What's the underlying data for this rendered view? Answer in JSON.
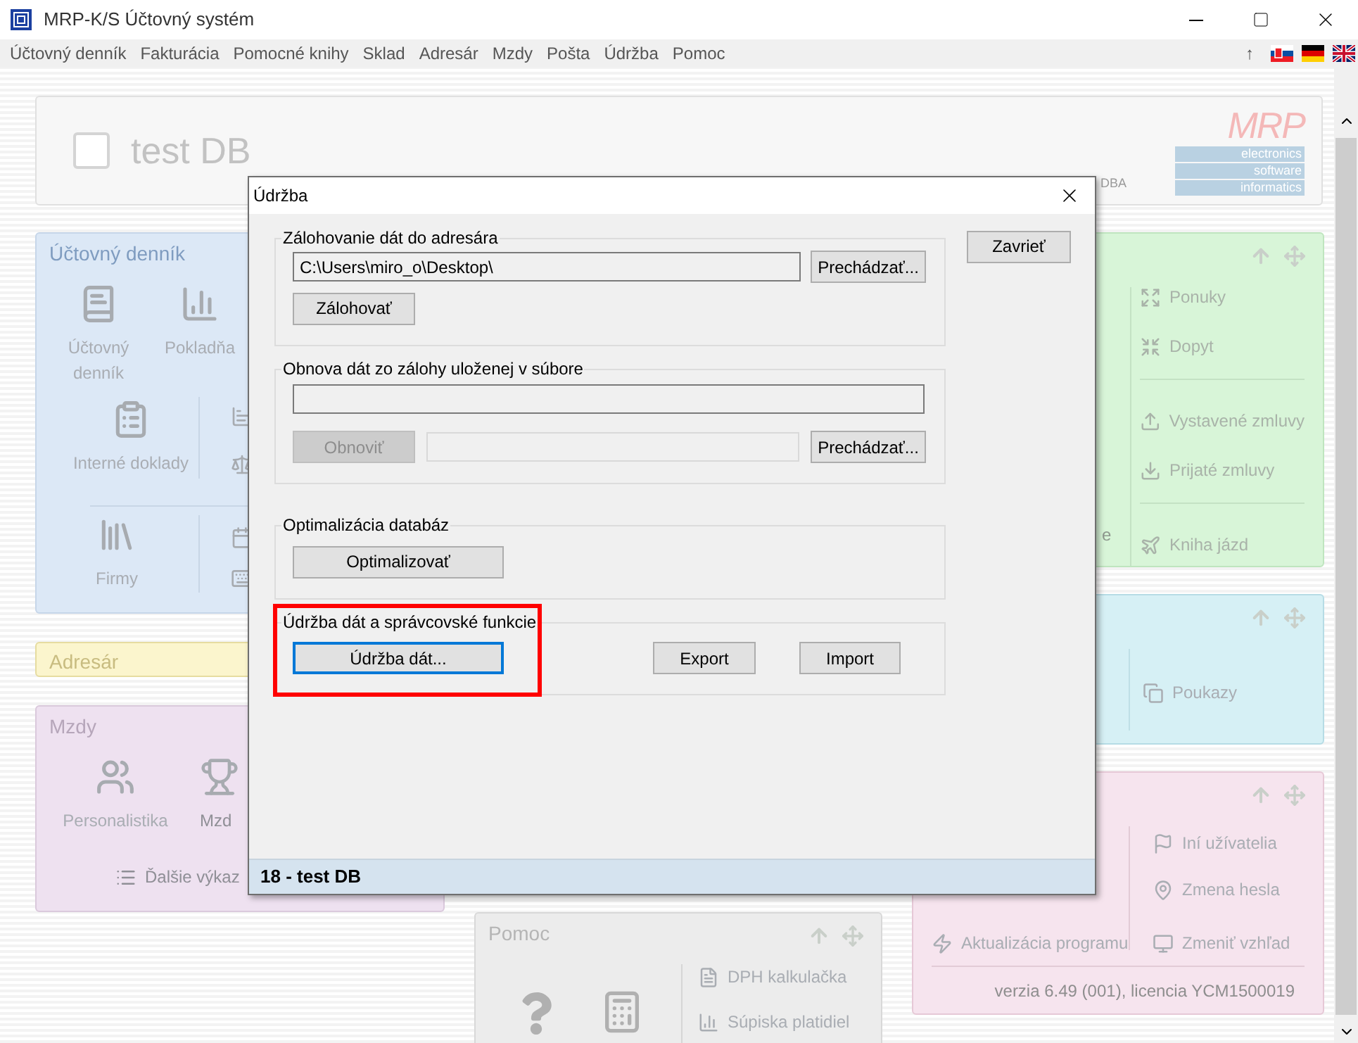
{
  "window": {
    "title": "MRP-K/S Účtovný systém"
  },
  "menu": {
    "items": [
      "Účtovný denník",
      "Fakturácia",
      "Pomocné knihy",
      "Sklad",
      "Adresár",
      "Mzdy",
      "Pošta",
      "Údržba",
      "Pomoc"
    ],
    "up_label": "↑"
  },
  "header": {
    "title": "test DB",
    "checked": false,
    "hidden_text": "DBA",
    "logo": {
      "mark": "MRP",
      "lines": [
        "electronics",
        "software",
        "informatics"
      ]
    }
  },
  "ledger_card": {
    "title": "Účtovný denník",
    "tiles": [
      "Účtovný denník",
      "Pokladňa",
      "Interné doklady",
      "Firmy"
    ]
  },
  "address_card": {
    "title": "Adresár"
  },
  "payroll_card": {
    "title": "Mzdy",
    "tiles": [
      "Personalistika",
      "Mzd"
    ],
    "link": "Ďalšie výkaz"
  },
  "help_card": {
    "title": "Pomoc",
    "links": [
      "DPH kalkulačka",
      "Súpiska platidiel"
    ]
  },
  "contracts_card": {
    "partial_label": "e",
    "link_groups": [
      {
        "links": [
          "Ponuky",
          "Dopyt"
        ]
      },
      {
        "links": [
          "Vystavené zmluvy",
          "Prijaté zmluvy"
        ]
      },
      {
        "links": [
          "Kniha jázd"
        ]
      }
    ]
  },
  "vouchers_card": {
    "links": [
      "Poukazy"
    ]
  },
  "settings_card": {
    "links": [
      "Iní užívatelia",
      "Zmena hesla"
    ],
    "update_link": "Aktualizácia programu",
    "look_link": "Zmeniť vzhľad",
    "version": "verzia 6.49 (001), licencia YCM1500019"
  },
  "dialog": {
    "title": "Údržba",
    "close_button": "Zavrieť",
    "status": "18 - test DB",
    "groups": [
      {
        "kind": "backup",
        "title": "Zálohovanie dát do adresára",
        "highlighted": false,
        "field": {
          "value": "C:\\Users\\miro_o\\Desktop\\"
        },
        "buttons": [
          {
            "label": "Prechádzať...",
            "disabled": false,
            "focused": false
          },
          {
            "label": "Zálohovať",
            "disabled": false,
            "focused": false
          }
        ]
      },
      {
        "kind": "restore",
        "title": "Obnova dát zo zálohy uloženej v súbore",
        "highlighted": false,
        "buttons": [
          {
            "label": "Obnoviť",
            "disabled": true,
            "focused": false
          },
          {
            "label": "Prechádzať...",
            "disabled": false,
            "focused": false
          }
        ]
      },
      {
        "kind": "optimize",
        "title": "Optimalizácia databáz",
        "highlighted": false,
        "buttons": [
          {
            "label": "Optimalizovať",
            "disabled": false,
            "focused": false
          }
        ]
      },
      {
        "kind": "maintenance",
        "title": "Údržba dát a správcovské funkcie",
        "highlighted": true,
        "buttons": [
          {
            "label": "Údržba dát...",
            "disabled": false,
            "focused": true
          },
          {
            "label": "Export",
            "disabled": false,
            "focused": false
          },
          {
            "label": "Import",
            "disabled": false,
            "focused": false
          }
        ]
      }
    ]
  }
}
